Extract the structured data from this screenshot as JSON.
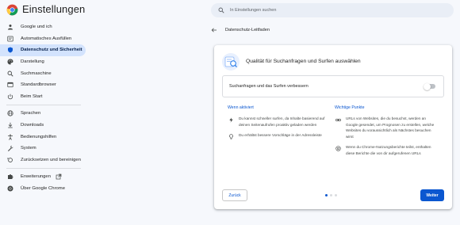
{
  "header": {
    "title": "Einstellungen",
    "search_placeholder": "In Einstellungen suchen"
  },
  "sidebar": {
    "items": [
      {
        "label": "Google und ich",
        "icon": "person-icon"
      },
      {
        "label": "Automatisches Ausfüllen",
        "icon": "autofill-icon"
      },
      {
        "label": "Datenschutz und Sicherheit",
        "icon": "shield-icon",
        "active": true
      },
      {
        "label": "Darstellung",
        "icon": "palette-icon"
      },
      {
        "label": "Suchmaschine",
        "icon": "search-icon"
      },
      {
        "label": "Standardbrowser",
        "icon": "browser-icon"
      },
      {
        "label": "Beim Start",
        "icon": "power-icon"
      }
    ],
    "advanced": [
      {
        "label": "Sprachen",
        "icon": "globe-icon"
      },
      {
        "label": "Downloads",
        "icon": "download-icon"
      },
      {
        "label": "Bedienungshilfen",
        "icon": "accessibility-icon"
      },
      {
        "label": "System",
        "icon": "wrench-icon"
      },
      {
        "label": "Zurücksetzen und bereinigen",
        "icon": "reset-icon"
      }
    ],
    "footer": [
      {
        "label": "Erweiterungen",
        "icon": "puzzle-icon"
      },
      {
        "label": "Über Google Chrome",
        "icon": "chrome-icon"
      }
    ]
  },
  "main": {
    "breadcrumb": "Datenschutz-Leitfaden",
    "card": {
      "title": "Qualität für Suchanfragen und Surfen auswählen",
      "toggle_label": "Suchanfragen und das Surfen verbessern",
      "toggle_on": false,
      "left_heading": "Wenn aktiviert",
      "left_points": [
        "Du kannst schneller surfen, da Inhalte basierend auf deinen Seitenaufrufen proaktiv geladen werden",
        "Du erhältst bessere Vorschläge in der Adressleiste"
      ],
      "right_heading": "Wichtige Punkte",
      "right_points": [
        "URLs von Websites, die du besuchst, werden an Google gesendet, um Prognosen zu erstellen, welche Websites du voraussichtlich als Nächstes besuchen wirst",
        "Wenn du Chrome-Nutzungsberichte teilst, enthalten diese Berichte die von dir aufgerufenen URLs"
      ],
      "back_label": "Zurück",
      "next_label": "Weiter",
      "step_current": 1,
      "step_total": 3
    }
  },
  "colors": {
    "accent": "#0b57d0",
    "active_bg": "#d3e3fd",
    "page_bg": "#f6f8fc"
  }
}
